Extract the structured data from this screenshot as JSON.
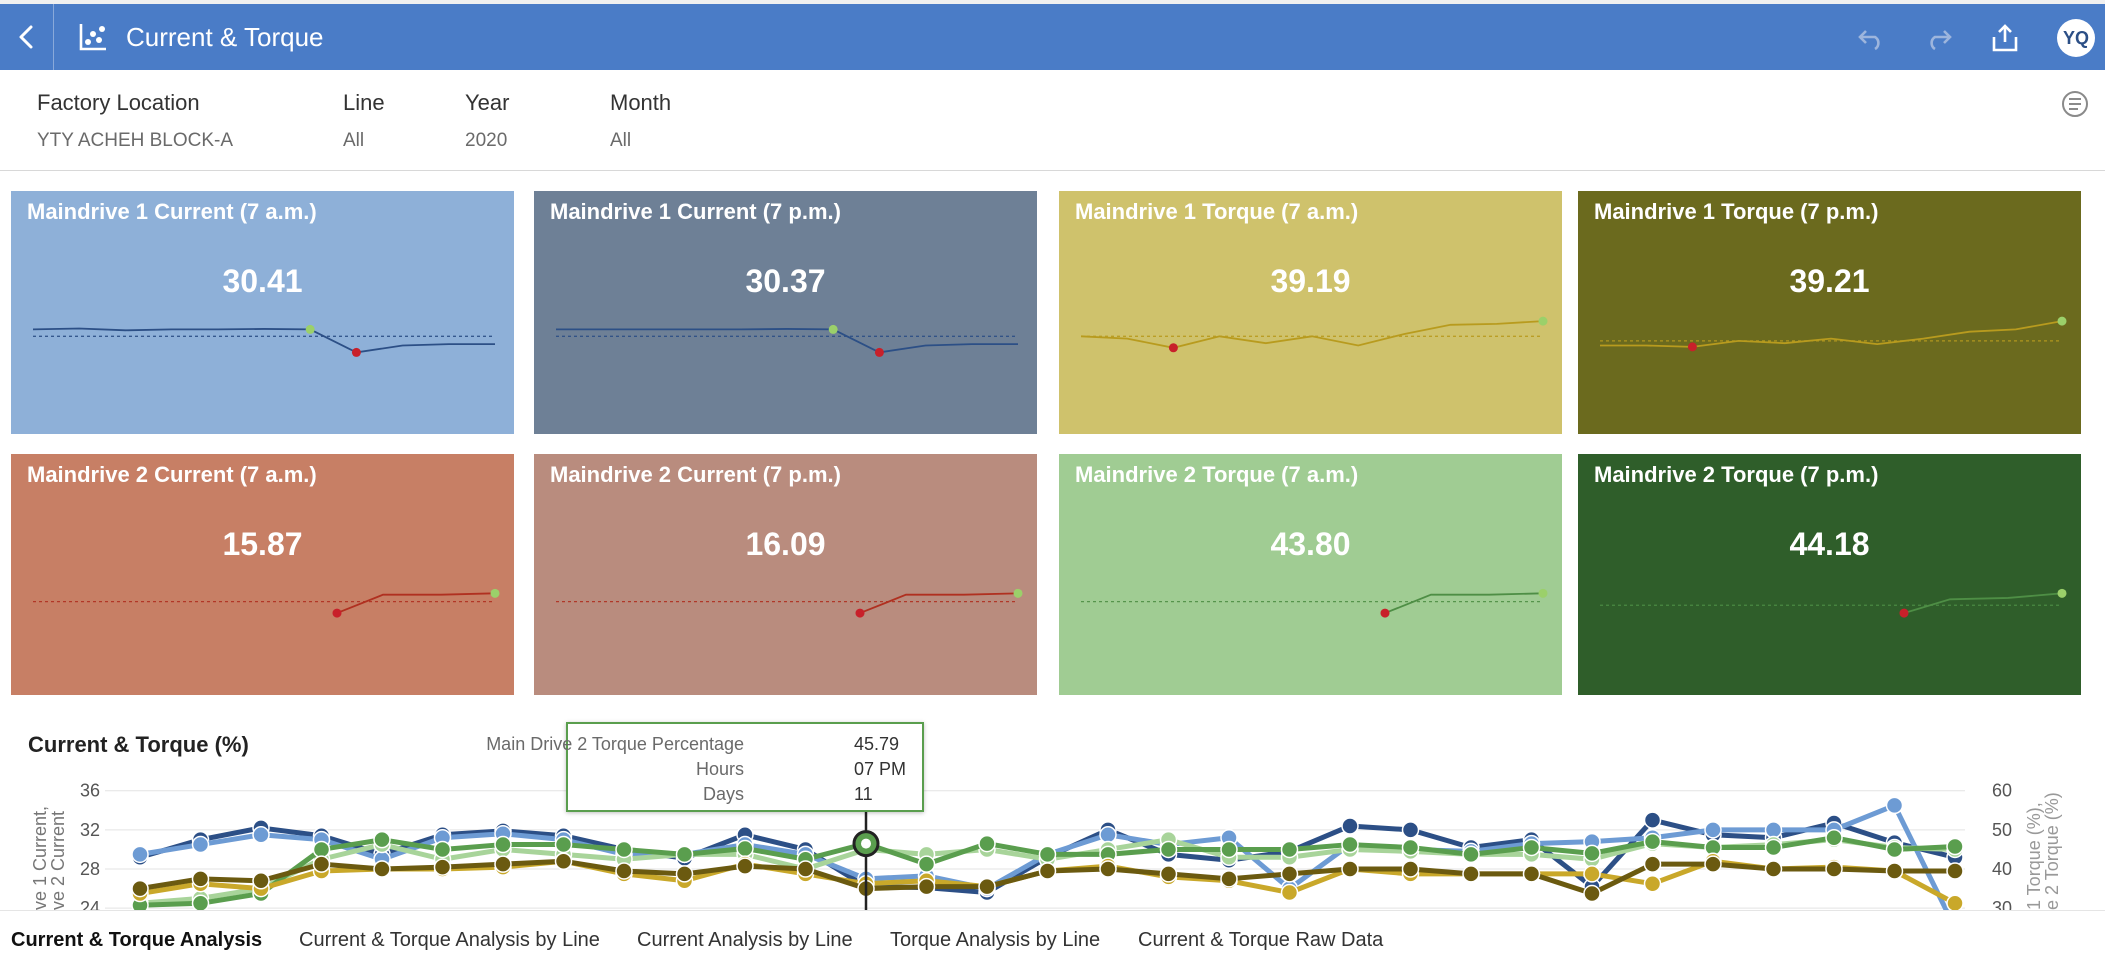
{
  "header": {
    "title": "Current & Torque",
    "avatar_initials": "YQ",
    "color": "#4a7cc7"
  },
  "filters": [
    {
      "label": "Factory Location",
      "value": "YTY ACHEH BLOCK-A"
    },
    {
      "label": "Line",
      "value": "All"
    },
    {
      "label": "Year",
      "value": "2020"
    },
    {
      "label": "Month",
      "value": "All"
    }
  ],
  "tiles": [
    {
      "title": "Maindrive 1 Current (7 a.m.)",
      "value": "30.41",
      "bg": "#8eb0d8",
      "line": "#2c4f86",
      "trend": [
        0.4,
        0.38,
        0.42,
        0.4,
        0.4,
        0.39,
        0.4,
        0.9,
        0.75,
        0.72,
        0.72
      ],
      "ref": 0.55
    },
    {
      "title": "Maindrive 1 Current (7 p.m.)",
      "value": "30.37",
      "bg": "#6e8096",
      "line": "#2c4f86",
      "trend": [
        0.4,
        0.4,
        0.4,
        0.4,
        0.4,
        0.39,
        0.4,
        0.9,
        0.75,
        0.72,
        0.72
      ],
      "ref": 0.55
    },
    {
      "title": "Maindrive 1 Torque (7 a.m.)",
      "value": "39.19",
      "bg": "#cfc26c",
      "line": "#b89b1e",
      "trend": [
        0.55,
        0.6,
        0.8,
        0.55,
        0.7,
        0.55,
        0.75,
        0.5,
        0.3,
        0.28,
        0.22
      ],
      "ref": 0.55
    },
    {
      "title": "Maindrive 1 Torque (7 p.m.)",
      "value": "39.21",
      "bg": "#6b6a1e",
      "line": "#b89b1e",
      "trend": [
        0.75,
        0.75,
        0.78,
        0.65,
        0.7,
        0.6,
        0.72,
        0.6,
        0.45,
        0.4,
        0.22
      ],
      "ref": 0.65
    },
    {
      "title": "Maindrive 2 Current (7 a.m.)",
      "value": "15.87",
      "bg": "#c77f65",
      "line": "#b03020",
      "trend": [
        0.85,
        0.45,
        0.45,
        0.42
      ],
      "ref": 0.6
    },
    {
      "title": "Maindrive 2 Current (7 p.m.)",
      "value": "16.09",
      "bg": "#b98c7e",
      "line": "#b03020",
      "trend": [
        0.85,
        0.45,
        0.45,
        0.42
      ],
      "ref": 0.6
    },
    {
      "title": "Maindrive 2 Torque (7 a.m.)",
      "value": "43.80",
      "bg": "#a0cc93",
      "line": "#4e8e45",
      "trend": [
        0.85,
        0.45,
        0.45,
        0.42
      ],
      "ref": 0.6
    },
    {
      "title": "Maindrive 2 Torque (7 p.m.)",
      "value": "44.18",
      "bg": "#2f5e2a",
      "line": "#4e8e45",
      "trend": [
        0.85,
        0.55,
        0.52,
        0.42
      ],
      "ref": 0.68
    }
  ],
  "chart": {
    "title": "Current & Torque (%)",
    "left_axis_label_1": "ve 1 Current,",
    "left_axis_label_2": "ve 2 Current",
    "right_axis_label_1": "1 Torque (%),",
    "right_axis_label_2": "e 2 Torque (%)",
    "left_ticks": [
      "36",
      "32",
      "28",
      "24"
    ],
    "right_ticks": [
      "60",
      "50",
      "40",
      "30"
    ]
  },
  "chart_data": {
    "type": "line",
    "y_left_ticks": [
      24,
      28,
      32,
      36
    ],
    "y_right_ticks": [
      30,
      40,
      50,
      60
    ],
    "series": [
      {
        "color": "#2c4f86",
        "values": [
          29.2,
          31.0,
          32.2,
          31.4,
          29.5,
          31.5,
          31.9,
          31.4,
          30.0,
          29.1,
          31.5,
          30.0,
          26.2,
          26.1,
          25.6,
          29.2,
          32.0,
          29.5,
          28.9,
          29.8,
          32.4,
          32.0,
          30.2,
          31.0,
          26.2,
          33.0,
          31.5,
          31.2,
          32.7,
          30.7,
          29.2
        ]
      },
      {
        "color": "#6d9bd4",
        "values": [
          29.5,
          30.5,
          31.5,
          31.0,
          29.0,
          31.2,
          31.6,
          31.0,
          29.5,
          29.5,
          30.5,
          29.5,
          27.0,
          27.3,
          26.0,
          29.5,
          31.5,
          30.5,
          31.2,
          26.0,
          30.5,
          30.0,
          29.8,
          30.6,
          30.8,
          31.2,
          32.0,
          32.0,
          32.0,
          34.5,
          22.0
        ]
      },
      {
        "color": "#a8d49a",
        "values": [
          24.5,
          25.0,
          26.0,
          29.0,
          30.5,
          29.0,
          30.0,
          29.5,
          29.0,
          29.5,
          29.5,
          28.0,
          30.0,
          29.5,
          30.0,
          29.0,
          30.0,
          31.0,
          29.2,
          29.2,
          30.0,
          29.8,
          29.5,
          29.5,
          29.0,
          30.6,
          30.2,
          30.5,
          31.0,
          30.2,
          30.0
        ]
      },
      {
        "color": "#5a9e4e",
        "values": [
          24.3,
          24.5,
          25.5,
          30.0,
          31.0,
          30.0,
          30.5,
          30.5,
          30.0,
          29.5,
          30.1,
          29.0,
          30.6,
          28.5,
          30.6,
          29.5,
          29.5,
          30.0,
          30.0,
          30.0,
          30.5,
          30.2,
          29.5,
          30.2,
          29.6,
          30.8,
          30.2,
          30.2,
          31.2,
          30.0,
          30.3
        ]
      },
      {
        "color": "#c9a82a",
        "values": [
          25.5,
          26.5,
          26.0,
          27.8,
          28.0,
          28.0,
          28.2,
          28.8,
          27.5,
          26.8,
          28.5,
          27.5,
          26.5,
          26.8,
          26.2,
          27.8,
          28.3,
          27.2,
          26.8,
          25.6,
          28.0,
          27.5,
          27.5,
          27.5,
          27.5,
          26.5,
          28.8,
          28.0,
          28.2,
          27.8,
          24.5
        ]
      },
      {
        "color": "#6b5a10",
        "values": [
          26.0,
          27.0,
          26.8,
          28.5,
          28.0,
          28.2,
          28.5,
          28.8,
          27.8,
          27.5,
          28.3,
          28.0,
          26.0,
          26.2,
          26.2,
          27.8,
          28.0,
          27.5,
          27.0,
          27.5,
          28.0,
          28.0,
          27.5,
          27.5,
          25.5,
          28.5,
          28.5,
          28.0,
          28.0,
          27.8,
          27.8
        ]
      }
    ]
  },
  "tooltip": {
    "rows": [
      {
        "key": "Main Drive 2 Torque Percentage",
        "value": "45.79"
      },
      {
        "key": "Hours",
        "value": "07 PM"
      },
      {
        "key": "Days",
        "value": "11"
      }
    ]
  },
  "tabs": [
    {
      "label": "Current & Torque Analysis",
      "active": true
    },
    {
      "label": "Current & Torque Analysis by Line",
      "active": false
    },
    {
      "label": "Current Analysis by Line",
      "active": false
    },
    {
      "label": "Torque Analysis by Line",
      "active": false
    },
    {
      "label": "Current & Torque Raw Data",
      "active": false
    }
  ]
}
